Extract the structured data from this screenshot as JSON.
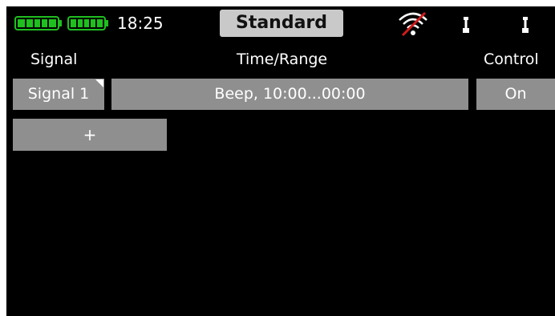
{
  "status_bar": {
    "time": "18:25",
    "profile_label": "Standard",
    "battery_color": "#1fbf1f",
    "icons": [
      "battery-icon",
      "battery-icon",
      "wifi-off-icon",
      "switch-icon",
      "switch-icon"
    ]
  },
  "table": {
    "headers": {
      "signal": "Signal",
      "time_range": "Time/Range",
      "control": "Control"
    },
    "rows": [
      {
        "signal": "Signal 1",
        "time_range": "Beep, 10:00...00:00",
        "control": "On"
      }
    ],
    "add_label": "+"
  },
  "colors": {
    "background": "#000000",
    "cell": "#8f8f8f",
    "profile_button": "#c9c9c9",
    "wifi_strike": "#d01c1c"
  }
}
